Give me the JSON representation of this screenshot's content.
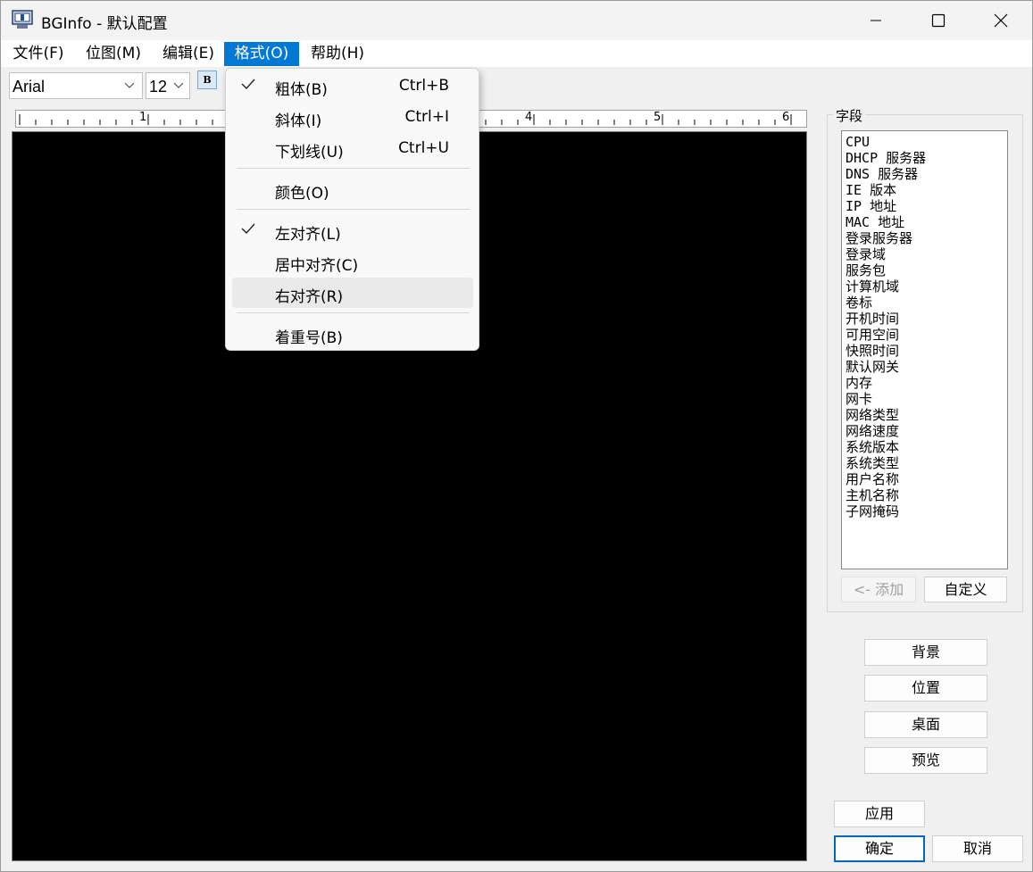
{
  "window": {
    "title": "BGInfo - 默认配置"
  },
  "menubar": [
    {
      "label": "文件(F)"
    },
    {
      "label": "位图(M)"
    },
    {
      "label": "编辑(E)"
    },
    {
      "label": "格式(O)"
    },
    {
      "label": "帮助(H)"
    }
  ],
  "toolbar": {
    "font_name": "Arial",
    "font_size": "12",
    "bold_label": "B"
  },
  "ruler": {
    "marks": [
      "1",
      "4",
      "5",
      "6"
    ]
  },
  "format_menu": {
    "items": [
      {
        "label": "粗体(B)",
        "shortcut": "Ctrl+B",
        "checked": true
      },
      {
        "label": "斜体(I)",
        "shortcut": "Ctrl+I",
        "checked": false
      },
      {
        "label": "下划线(U)",
        "shortcut": "Ctrl+U",
        "checked": false
      },
      {
        "label": "颜色(O)",
        "shortcut": "",
        "checked": false
      },
      {
        "label": "左对齐(L)",
        "shortcut": "",
        "checked": true
      },
      {
        "label": "居中对齐(C)",
        "shortcut": "",
        "checked": false
      },
      {
        "label": "右对齐(R)",
        "shortcut": "",
        "checked": false,
        "highlighted": true
      },
      {
        "label": "着重号(B)",
        "shortcut": "",
        "checked": false
      }
    ]
  },
  "fields": {
    "group_label": "字段",
    "items": [
      "CPU",
      "DHCP 服务器",
      "DNS 服务器",
      "IE 版本",
      "IP 地址",
      "MAC 地址",
      "登录服务器",
      "登录域",
      "服务包",
      "计算机域",
      "卷标",
      "开机时间",
      "可用空间",
      "快照时间",
      "默认网关",
      "内存",
      "网卡",
      "网络类型",
      "网络速度",
      "系统版本",
      "系统类型",
      "用户名称",
      "主机名称",
      "子网掩码"
    ],
    "add_button": "<- 添加",
    "custom_button": "自定义"
  },
  "side_buttons": {
    "background": "背景",
    "position": "位置",
    "desktop": "桌面",
    "preview": "预览"
  },
  "footer": {
    "apply": "应用",
    "ok": "确定",
    "cancel": "取消"
  }
}
